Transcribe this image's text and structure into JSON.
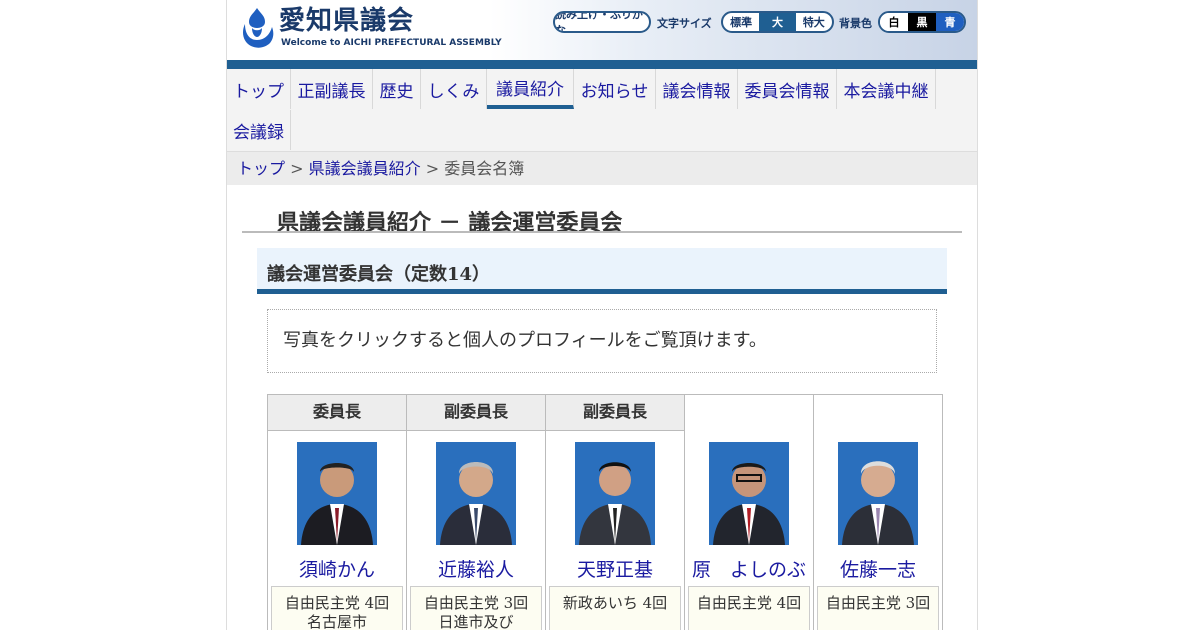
{
  "header": {
    "logo_title": "愛知県議会",
    "logo_subtitle": "Welcome to AICHI PREFECTURAL ASSEMBLY",
    "read_aloud": "読み上げ・ふりがな",
    "font_size_label": "文字サイズ",
    "font_sizes": [
      "標準",
      "大",
      "特大"
    ],
    "bg_color_label": "背景色",
    "bg_colors": [
      "白",
      "黒",
      "青"
    ]
  },
  "nav": {
    "items": [
      "トップ",
      "正副議長",
      "歴史",
      "しくみ",
      "議員紹介",
      "お知らせ",
      "議会情報",
      "委員会情報",
      "本会議中継",
      "会議録"
    ],
    "active": "議員紹介"
  },
  "breadcrumb": {
    "home": "トップ",
    "sep1": ">",
    "parent": "県議会議員紹介",
    "sep2": ">",
    "current": "委員会名簿"
  },
  "page_title": "県議会議員紹介 － 議会運営委員会",
  "section_title": "議会運営委員会（定数14）",
  "notice": "写真をクリックすると個人のプロフィールをご覧頂けます。",
  "members": [
    {
      "role": "委員長",
      "name": "須崎かん",
      "party": "自由民主党 4回",
      "district": "名古屋市"
    },
    {
      "role": "副委員長",
      "name": "近藤裕人",
      "party": "自由民主党 3回",
      "district": "日進市及び"
    },
    {
      "role": "副委員長",
      "name": "天野正基",
      "party": "新政あいち 4回",
      "district": ""
    },
    {
      "role": "",
      "name": "原　よしのぶ",
      "party": "自由民主党 4回",
      "district": ""
    },
    {
      "role": "",
      "name": "佐藤一志",
      "party": "自由民主党 3回",
      "district": ""
    }
  ],
  "colors": {
    "brand_blue": "#1f5f92",
    "link": "#1a1aa0",
    "photo_bg": "#2a6fbd"
  }
}
